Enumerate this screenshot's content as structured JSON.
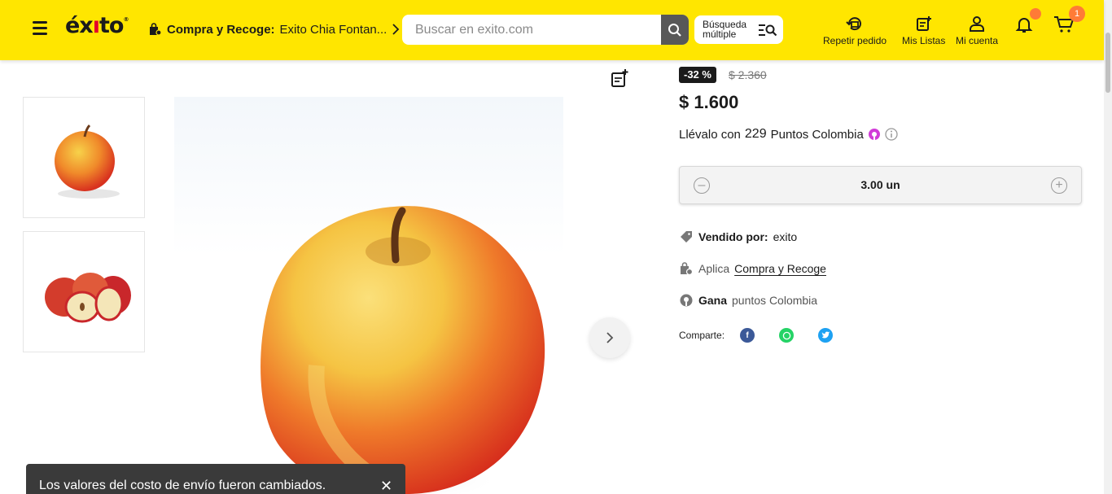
{
  "header": {
    "logo_text": "éxito",
    "pickup_label": "Compra y Recoge:",
    "pickup_store": "Exito Chia Fontan...",
    "search_placeholder": "Buscar en exito.com",
    "multi_search_label": "Búsqueda múltiple",
    "nav": [
      {
        "label": "Repetir pedido",
        "icon": "repeat-order-icon"
      },
      {
        "label": "Mis Listas",
        "icon": "lists-icon"
      },
      {
        "label": "Mi cuenta",
        "icon": "user-icon"
      }
    ],
    "cart_count": "1",
    "brand_color": "#ffe600",
    "accent_color": "#ff7b36"
  },
  "product": {
    "discount_badge": "-32 %",
    "old_price": "$ 2.360",
    "price": "$ 1.600",
    "points_prefix": "Llévalo con",
    "points_value": "229",
    "points_suffix": "Puntos Colombia",
    "quantity": "3.00 un",
    "sold_by_label": "Vendido por:",
    "sold_by_value": "exito",
    "pickup_prefix": "Aplica",
    "pickup_link": "Compra y Recoge",
    "earn_label": "Gana",
    "earn_value": "puntos Colombia",
    "share_label": "Comparte:"
  },
  "toast": {
    "message": "Los valores del costo de envío fueron cambiados.",
    "close": "✕"
  }
}
